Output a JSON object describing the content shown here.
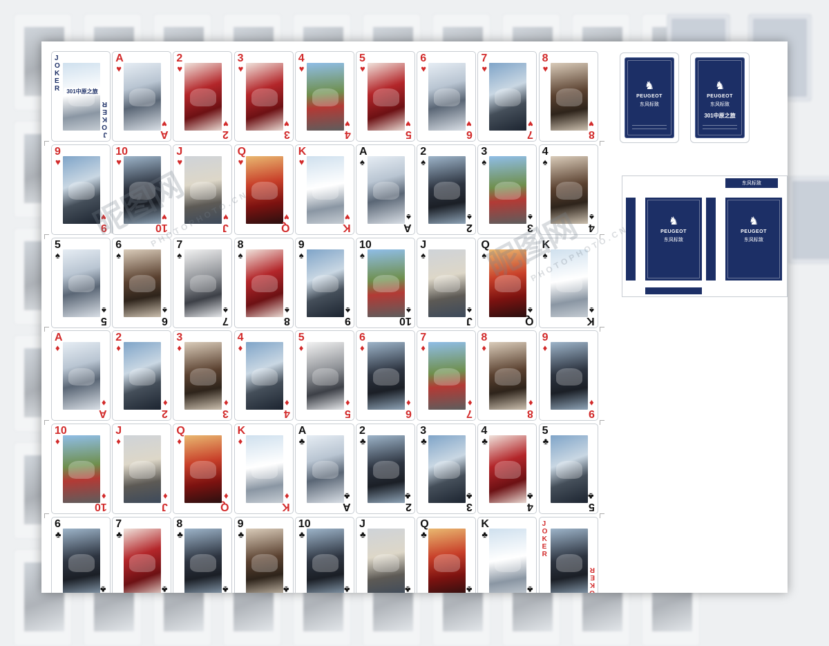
{
  "sheet": {
    "rows": [
      [
        {
          "rank": "JOKER",
          "color": "blue",
          "photo": "ph8",
          "caption": "301中原之旅",
          "joker": true
        },
        {
          "rank": "A",
          "suit": "♥",
          "color": "red",
          "photo": "ph0"
        },
        {
          "rank": "2",
          "suit": "♥",
          "color": "red",
          "photo": "ph2"
        },
        {
          "rank": "3",
          "suit": "♥",
          "color": "red",
          "photo": "ph2"
        },
        {
          "rank": "4",
          "suit": "♥",
          "color": "red",
          "photo": "ph3"
        },
        {
          "rank": "5",
          "suit": "♥",
          "color": "red",
          "photo": "ph2"
        },
        {
          "rank": "6",
          "suit": "♥",
          "color": "red",
          "photo": "ph0"
        },
        {
          "rank": "7",
          "suit": "♥",
          "color": "red",
          "photo": "ph6"
        },
        {
          "rank": "8",
          "suit": "♥",
          "color": "red",
          "photo": "ph5"
        }
      ],
      [
        {
          "rank": "9",
          "suit": "♥",
          "color": "red",
          "photo": "ph6"
        },
        {
          "rank": "10",
          "suit": "♥",
          "color": "red",
          "photo": "ph1"
        },
        {
          "rank": "J",
          "suit": "♥",
          "color": "red",
          "photo": "ph9"
        },
        {
          "rank": "Q",
          "suit": "♥",
          "color": "red",
          "photo": "ph7"
        },
        {
          "rank": "K",
          "suit": "♥",
          "color": "red",
          "photo": "ph8"
        },
        {
          "rank": "A",
          "suit": "♠",
          "color": "black",
          "photo": "ph0"
        },
        {
          "rank": "2",
          "suit": "♠",
          "color": "black",
          "photo": "ph1"
        },
        {
          "rank": "3",
          "suit": "♠",
          "color": "black",
          "photo": "ph3"
        },
        {
          "rank": "4",
          "suit": "♠",
          "color": "black",
          "photo": "ph5"
        }
      ],
      [
        {
          "rank": "5",
          "suit": "♠",
          "color": "black",
          "photo": "ph0"
        },
        {
          "rank": "6",
          "suit": "♠",
          "color": "black",
          "photo": "ph5"
        },
        {
          "rank": "7",
          "suit": "♠",
          "color": "black",
          "photo": "ph4"
        },
        {
          "rank": "8",
          "suit": "♠",
          "color": "black",
          "photo": "ph2"
        },
        {
          "rank": "9",
          "suit": "♠",
          "color": "black",
          "photo": "ph6"
        },
        {
          "rank": "10",
          "suit": "♠",
          "color": "black",
          "photo": "ph3"
        },
        {
          "rank": "J",
          "suit": "♠",
          "color": "black",
          "photo": "ph9"
        },
        {
          "rank": "Q",
          "suit": "♠",
          "color": "black",
          "photo": "ph7"
        },
        {
          "rank": "K",
          "suit": "♠",
          "color": "black",
          "photo": "ph8"
        }
      ],
      [
        {
          "rank": "A",
          "suit": "♦",
          "color": "red",
          "photo": "ph0"
        },
        {
          "rank": "2",
          "suit": "♦",
          "color": "red",
          "photo": "ph6"
        },
        {
          "rank": "3",
          "suit": "♦",
          "color": "red",
          "photo": "ph5"
        },
        {
          "rank": "4",
          "suit": "♦",
          "color": "red",
          "photo": "ph6"
        },
        {
          "rank": "5",
          "suit": "♦",
          "color": "red",
          "photo": "ph4"
        },
        {
          "rank": "6",
          "suit": "♦",
          "color": "red",
          "photo": "ph1"
        },
        {
          "rank": "7",
          "suit": "♦",
          "color": "red",
          "photo": "ph3"
        },
        {
          "rank": "8",
          "suit": "♦",
          "color": "red",
          "photo": "ph5"
        },
        {
          "rank": "9",
          "suit": "♦",
          "color": "red",
          "photo": "ph1"
        }
      ],
      [
        {
          "rank": "10",
          "suit": "♦",
          "color": "red",
          "photo": "ph3"
        },
        {
          "rank": "J",
          "suit": "♦",
          "color": "red",
          "photo": "ph9"
        },
        {
          "rank": "Q",
          "suit": "♦",
          "color": "red",
          "photo": "ph7"
        },
        {
          "rank": "K",
          "suit": "♦",
          "color": "red",
          "photo": "ph8"
        },
        {
          "rank": "A",
          "suit": "♣",
          "color": "black",
          "photo": "ph0"
        },
        {
          "rank": "2",
          "suit": "♣",
          "color": "black",
          "photo": "ph1"
        },
        {
          "rank": "3",
          "suit": "♣",
          "color": "black",
          "photo": "ph6"
        },
        {
          "rank": "4",
          "suit": "♣",
          "color": "black",
          "photo": "ph2"
        },
        {
          "rank": "5",
          "suit": "♣",
          "color": "black",
          "photo": "ph6"
        }
      ],
      [
        {
          "rank": "6",
          "suit": "♣",
          "color": "black",
          "photo": "ph1"
        },
        {
          "rank": "7",
          "suit": "♣",
          "color": "black",
          "photo": "ph2"
        },
        {
          "rank": "8",
          "suit": "♣",
          "color": "black",
          "photo": "ph1"
        },
        {
          "rank": "9",
          "suit": "♣",
          "color": "black",
          "photo": "ph5"
        },
        {
          "rank": "10",
          "suit": "♣",
          "color": "black",
          "photo": "ph1"
        },
        {
          "rank": "J",
          "suit": "♣",
          "color": "black",
          "photo": "ph9"
        },
        {
          "rank": "Q",
          "suit": "♣",
          "color": "black",
          "photo": "ph7"
        },
        {
          "rank": "K",
          "suit": "♣",
          "color": "black",
          "photo": "ph8"
        },
        {
          "rank": "JOKER",
          "color": "red",
          "photo": "ph1",
          "joker": true
        }
      ]
    ]
  },
  "card_back": {
    "brand": "PEUGEOT",
    "brand_cn": "东风标致",
    "slogan": "301中原之旅",
    "logo_icon": "lion-icon",
    "navy": "#1c2f66"
  },
  "box": {
    "strip_label": "东风标致",
    "brand": "PEUGEOT",
    "brand_cn": "东风标致"
  },
  "watermark": {
    "cn": "昵图网",
    "en": "PHOTOPHOTO.CN"
  },
  "colors": {
    "red": "#d22a2a",
    "black": "#111111",
    "joker_blue": "#1c2f66"
  }
}
